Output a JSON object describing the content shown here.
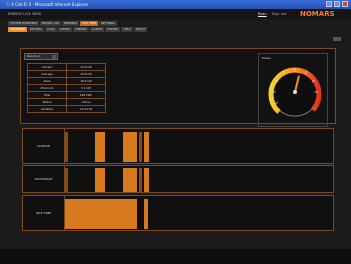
{
  "window": {
    "title": "ⓘ 4 Cell Fl 4 - Microsoft Internet Explorer"
  },
  "menubar": {
    "left": "ENERGY LIVE VIEW",
    "user": "Ryan",
    "logout": "Sign out",
    "logo": "NOMARS"
  },
  "tabs_primary": [
    "SYSTEM OVERVIEW",
    "DEVICE LIST",
    "REPORTS",
    "LIVE VIEW",
    "SETTINGS"
  ],
  "tabs_primary_active": 3,
  "tabs_secondary": [
    "OVERVIEW",
    "DEVICES",
    "LOGS",
    "ALERTS",
    "TRENDS",
    "CONFIG",
    "EXPORT",
    "HELP",
    "ABOUT"
  ],
  "tabs_secondary_active": 0,
  "selector": {
    "value": "Device A"
  },
  "stats": [
    [
      "Current",
      "12.4 kW"
    ],
    [
      "Average",
      "10.8 kW"
    ],
    [
      "Peak",
      "18.2 kW"
    ],
    [
      "Minimum",
      "3.1 kW"
    ],
    [
      "Total",
      "248 kWh"
    ],
    [
      "Status",
      "Online"
    ],
    [
      "Updated",
      "12:04:33"
    ]
  ],
  "gauge": {
    "label": "Power",
    "level": 0.55
  },
  "rows": [
    {
      "name": "CHARGE"
    },
    {
      "name": "DISCHARGE"
    },
    {
      "name": "IDLE TIME"
    }
  ]
}
